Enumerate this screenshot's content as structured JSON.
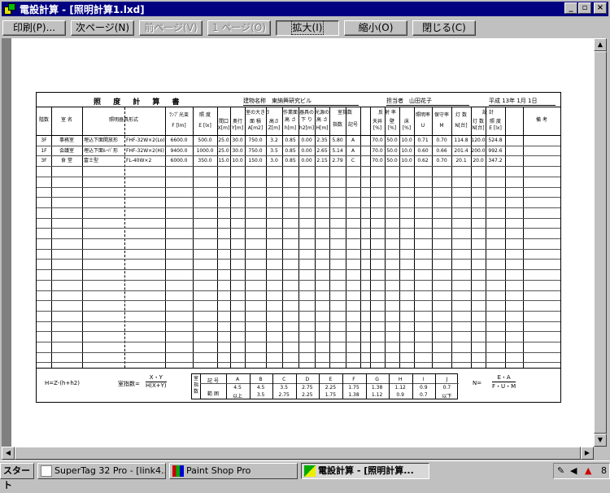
{
  "window": {
    "title": "電設計算 - [照明計算1.lxd]"
  },
  "toolbar": {
    "print": "印刷(P)...",
    "next_page": "次ページ(N)",
    "prev_page": "前ページ(V)",
    "one_page": "1 ページ(O)",
    "zoom_in": "拡大(I)",
    "zoom_out": "縮小(O)",
    "close": "閉じる(C)"
  },
  "doc": {
    "title": "照 度 計 算 書",
    "building": "建物名称　東納興研究ビル",
    "responsible": "担当者　山田花子",
    "date": "平成 13年 1月 1日",
    "headers": {
      "floor": "階数",
      "room": "室 名",
      "fixture": "照明器具形式",
      "lamp_flux": "ﾗﾝﾌﾟ光束",
      "lamp_flux_unit": "F [lm]",
      "illum": "照 度",
      "illum_unit": "E [lx]",
      "size": "室の大きさ",
      "width": "間口",
      "width_unit": "X[m]",
      "depth": "奥行",
      "depth_unit": "Y[m]",
      "area": "面 積",
      "area_unit": "A[m2]",
      "height": "高さ",
      "height_unit": "Z[m]",
      "work": "作業面",
      "work2": "高 さ",
      "work_unit": "h[m]",
      "hang": "器具の",
      "hang2": "下 り",
      "hang_unit": "h2[m]",
      "light": "光源の",
      "light2": "高 さ",
      "light_unit": "H[m]",
      "index": "室指数",
      "index_val": "指数",
      "index_sym": "記号",
      "refl": "反 射 率",
      "ceil": "天井",
      "wall": "壁",
      "floor_r": "床",
      "pct": "[%]",
      "util": "照明率",
      "util_sym": "U",
      "maint": "保守率",
      "maint_sym": "M",
      "lamps": "灯 数",
      "lamps_unit": "N[台]",
      "design": "設 計",
      "d_lamps": "灯 数",
      "d_lamps_unit": "N[台]",
      "d_illum": "照 度",
      "d_illum_unit": "E [lx]",
      "notes": "備 考"
    },
    "rows": [
      {
        "floor": "3F",
        "room": "事務室",
        "fixture": "埋込下面開放形",
        "model": "FHF-32W×2(Lo)",
        "flux": "6600.0",
        "illum": "500.0",
        "x": "25.0",
        "y": "30.0",
        "a": "750.0",
        "z": "3.2",
        "h": "0.85",
        "h2": "0.00",
        "hh": "2.35",
        "k": "5.80",
        "ks": "A",
        "c": "70.0",
        "w": "50.0",
        "f": "10.0",
        "u": "0.71",
        "m": "0.70",
        "n": "114.8",
        "dn": "120.0",
        "de": "524.8"
      },
      {
        "floor": "1F",
        "room": "会議室",
        "fixture": "埋込下面ﾙｰﾊﾞ形",
        "model": "FHF-32W×2(Hi)",
        "flux": "9400.0",
        "illum": "1000.0",
        "x": "25.0",
        "y": "30.0",
        "a": "750.0",
        "z": "3.5",
        "h": "0.85",
        "h2": "0.00",
        "hh": "2.65",
        "k": "5.14",
        "ks": "A",
        "c": "70.0",
        "w": "50.0",
        "f": "10.0",
        "u": "0.60",
        "m": "0.66",
        "n": "201.4",
        "dn": "200.0",
        "de": "992.6"
      },
      {
        "floor": "3F",
        "room": "食 堂",
        "fixture": "富士型",
        "model": "FL-40W×2",
        "flux": "6000.0",
        "illum": "350.0",
        "x": "15.0",
        "y": "10.0",
        "a": "150.0",
        "z": "3.0",
        "h": "0.85",
        "h2": "0.00",
        "hh": "2.15",
        "k": "2.79",
        "ks": "C",
        "c": "70.0",
        "w": "50.0",
        "f": "10.0",
        "u": "0.62",
        "m": "0.70",
        "n": "20.1",
        "dn": "20.0",
        "de": "347.2"
      }
    ],
    "footer": {
      "h_formula": "H=Z-(h+h2)",
      "index_label": "室指数=",
      "index_num": "X・Y",
      "index_den": "H(X+Y)",
      "tbl_label": "室指数",
      "sym_label": "記 号",
      "range_label": "範 囲",
      "syms": [
        "A",
        "B",
        "C",
        "D",
        "E",
        "F",
        "G",
        "H",
        "I",
        "J"
      ],
      "upper": [
        "4.5",
        "4.5",
        "3.5",
        "2.75",
        "2.25",
        "1.75",
        "1.38",
        "1.12",
        "0.9",
        "0.7"
      ],
      "lower": [
        "以上",
        "3.5",
        "2.75",
        "2.25",
        "1.75",
        "1.38",
        "1.12",
        "0.9",
        "0.7",
        "以下"
      ],
      "n_label": "N=",
      "n_num": "E・A",
      "n_den": "F・U・M"
    }
  },
  "taskbar": {
    "start": "スタート",
    "task1": "SuperTag 32 Pro - [link4...",
    "task2": "Paint Shop Pro",
    "task3": "電設計算 - [照明計算...",
    "clock": "8"
  }
}
